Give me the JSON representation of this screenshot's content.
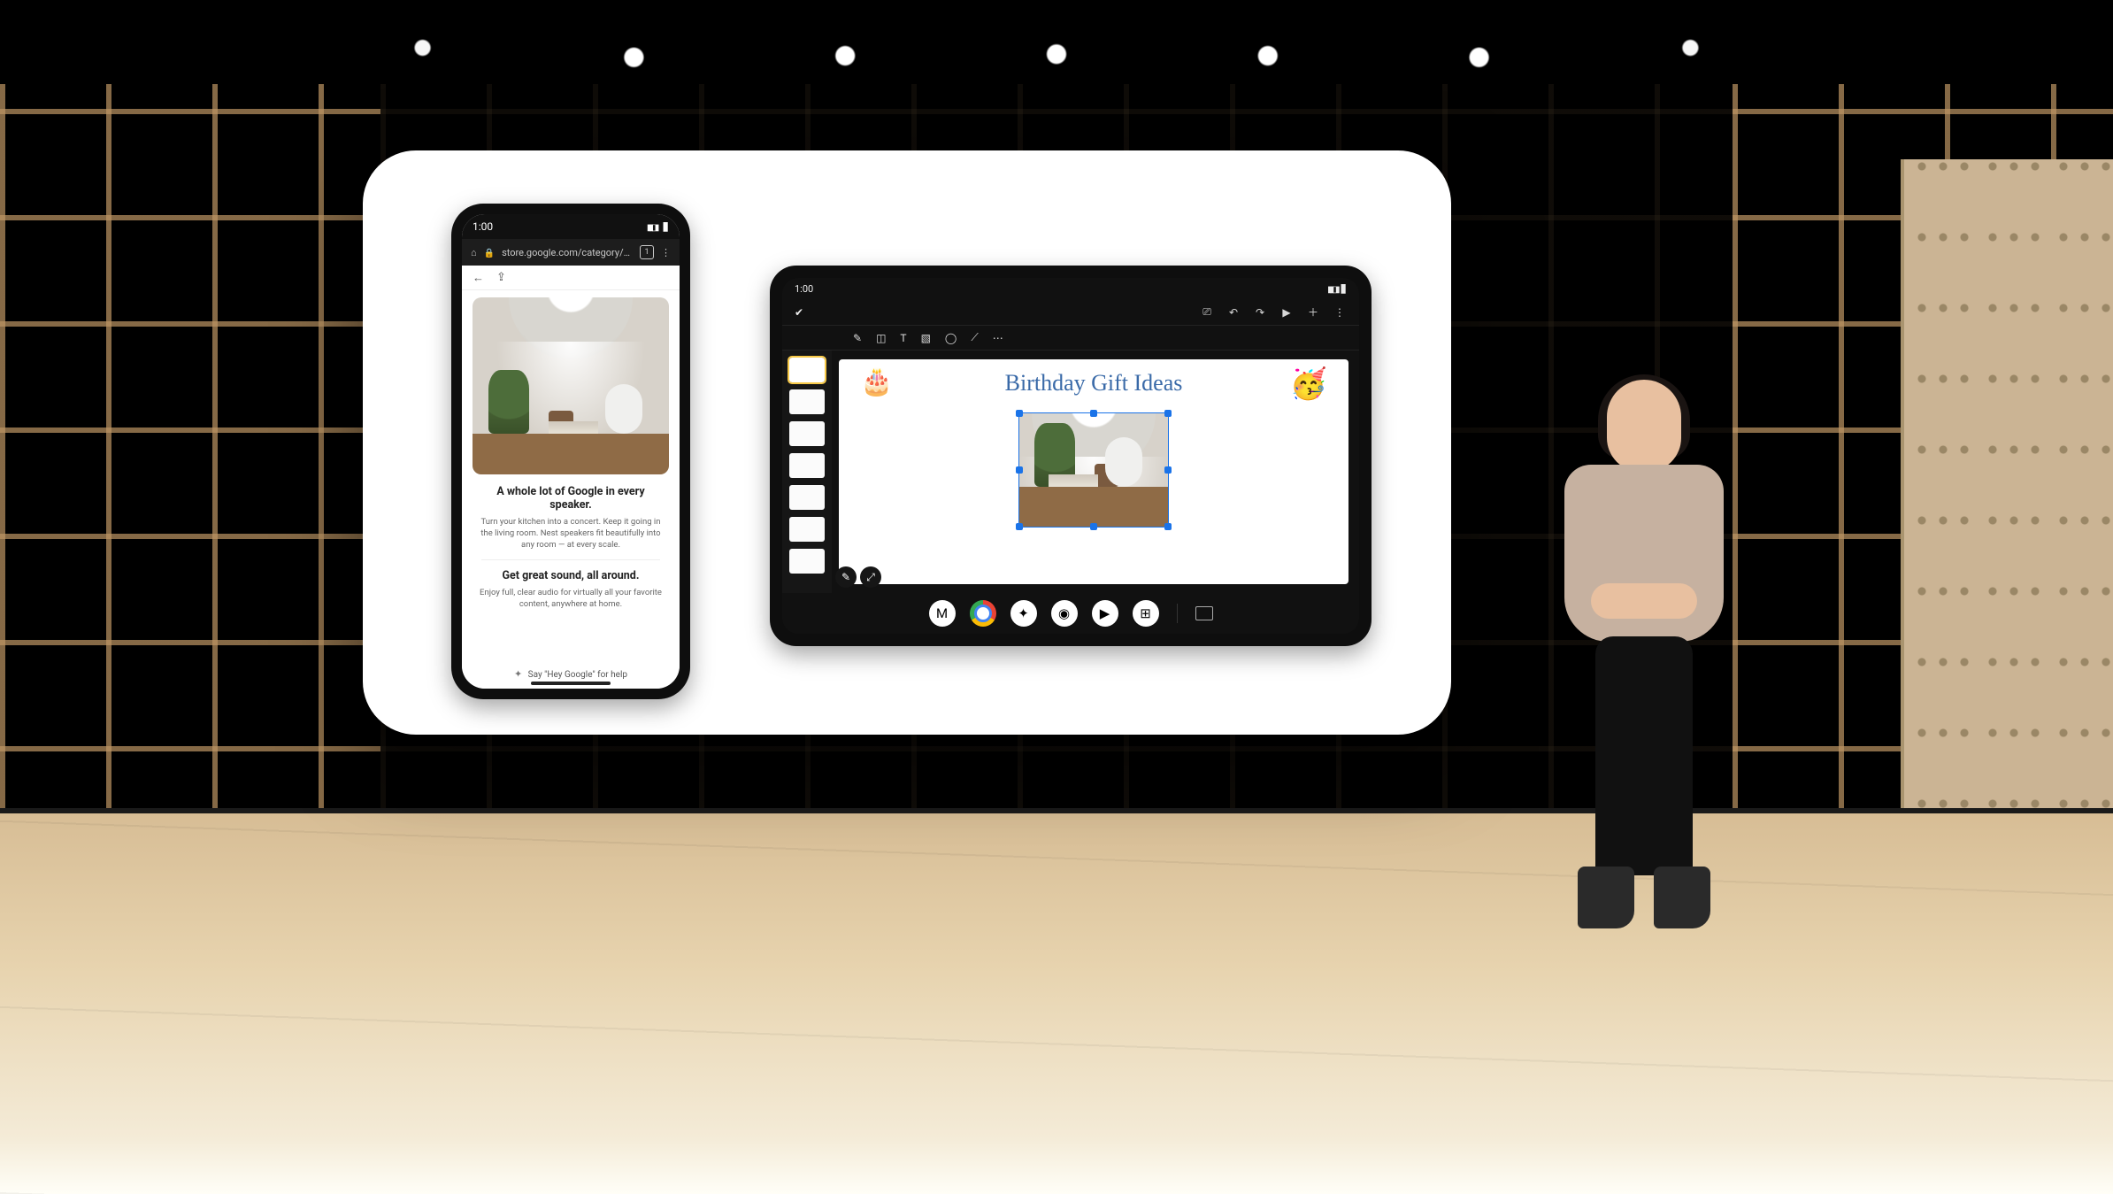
{
  "phone": {
    "status": {
      "time": "1:00"
    },
    "url": "store.google.com/category/nest...",
    "tab_count": "1",
    "product": {
      "headline": "A whole lot of Google in every speaker.",
      "sub1": "Turn your kitchen into a concert. Keep it going in the living room. Nest speakers fit beautifully into any room — at every scale.",
      "headline2": "Get great sound, all around.",
      "sub2": "Enjoy full, clear audio for virtually all your favorite content, anywhere at home."
    },
    "assistant_hint": "Say \"Hey Google\" for help"
  },
  "tablet": {
    "status": {
      "time": "1:00"
    },
    "slide": {
      "title": "Birthday Gift Ideas",
      "sticker_left": "🎂",
      "sticker_right": "🥳"
    },
    "thumb_count": 7,
    "dock": {
      "gmail": "M",
      "assistant": "✦",
      "camera": "◉",
      "youtube": "▶",
      "apps": "⊞"
    }
  }
}
